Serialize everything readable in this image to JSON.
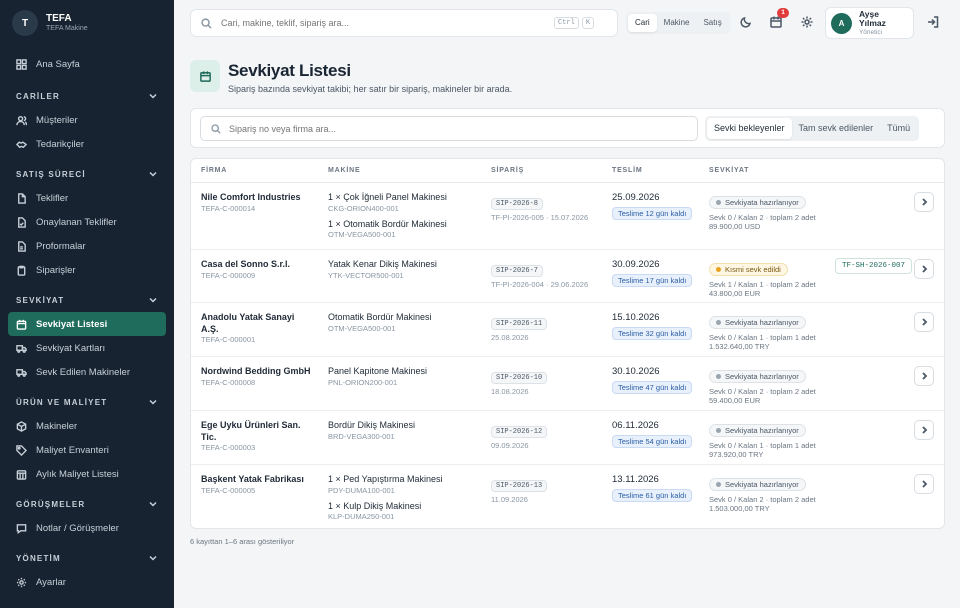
{
  "brand": {
    "logo_letter": "T",
    "name": "TEFA",
    "subtitle": "TEFA Makine"
  },
  "sidebar": {
    "home": "Ana Sayfa",
    "sections": [
      {
        "title": "CARİLER",
        "items": [
          "Müşteriler",
          "Tedarikçiler"
        ]
      },
      {
        "title": "SATIŞ SÜRECİ",
        "items": [
          "Teklifler",
          "Onaylanan Teklifler",
          "Proformalar",
          "Siparişler"
        ]
      },
      {
        "title": "SEVKİYAT",
        "items": [
          "Sevkiyat Listesi",
          "Sevkiyat Kartları",
          "Sevk Edilen Makineler"
        ]
      },
      {
        "title": "ÜRÜN VE MALİYET",
        "items": [
          "Makineler",
          "Maliyet Envanteri",
          "Aylık Maliyet Listesi"
        ]
      },
      {
        "title": "GÖRÜŞMELER",
        "items": [
          "Notlar / Görüşmeler"
        ]
      },
      {
        "title": "YÖNETİM",
        "items": [
          "Ayarlar"
        ]
      }
    ],
    "active_item": "Sevkiyat Listesi"
  },
  "topbar": {
    "search_placeholder": "Cari, makine, teklif, sipariş ara...",
    "kbd1": "Ctrl",
    "kbd2": "K",
    "scopes": [
      "Cari",
      "Makine",
      "Satış"
    ],
    "active_scope": "Cari",
    "notification_count": "1",
    "user_initial": "A",
    "user_name": "Ayşe Yılmaz",
    "user_role": "Yönetici"
  },
  "page": {
    "title": "Sevkiyat Listesi",
    "subtitle": "Sipariş bazında sevkiyat takibi; her satır bir sipariş, makineler bir arada."
  },
  "filters": {
    "search_placeholder": "Sipariş no veya firma ara...",
    "tabs": [
      "Sevki bekleyenler",
      "Tam sevk edilenler",
      "Tümü"
    ],
    "active_tab": "Sevki bekleyenler"
  },
  "table": {
    "headers": [
      "FİRMA",
      "MAKİNE",
      "SİPARİŞ",
      "TESLİM",
      "SEVKİYAT"
    ],
    "rows": [
      {
        "firm": "Nile Comfort Industries",
        "firm_code": "TEFA-C-000014",
        "machines": [
          {
            "name": "1 × Çok İğneli Panel Makinesi",
            "code": "CKG-ORION400-001"
          },
          {
            "name": "1 × Otomatik Bordür Makinesi",
            "code": "OTM-VEGA500-001"
          }
        ],
        "order_no": "SIP-2026-8",
        "order_meta": "TF-PI-2026-005 · 15.07.2026",
        "delivery_date": "25.09.2026",
        "delivery_badge": "Teslime 12 gün kaldı",
        "status": "Sevkiyata hazırlanıyor",
        "status_type": "neutral",
        "ship_meta": "Sevk 0 / Kalan 2 · toplam 2 adet",
        "amount": "89.900,00 USD",
        "tag": ""
      },
      {
        "firm": "Casa del Sonno S.r.l.",
        "firm_code": "TEFA-C-000009",
        "machines": [
          {
            "name": "Yatak Kenar Dikiş Makinesi",
            "code": "YTK-VECTOR500-001"
          }
        ],
        "order_no": "SIP-2026-7",
        "order_meta": "TF-PI-2026-004 · 29.06.2026",
        "delivery_date": "30.09.2026",
        "delivery_badge": "Teslime 17 gün kaldı",
        "status": "Kısmi sevk edildi",
        "status_type": "warn",
        "ship_meta": "Sevk 1 / Kalan 1 · toplam 2 adet",
        "amount": "43.800,00 EUR",
        "tag": "TF-SH-2026-007"
      },
      {
        "firm": "Anadolu Yatak Sanayi A.Ş.",
        "firm_code": "TEFA-C-000001",
        "machines": [
          {
            "name": "Otomatik Bordür Makinesi",
            "code": "OTM-VEGA500-001"
          }
        ],
        "order_no": "SIP-2026-11",
        "order_meta": "25.08.2026",
        "delivery_date": "15.10.2026",
        "delivery_badge": "Teslime 32 gün kaldı",
        "status": "Sevkiyata hazırlanıyor",
        "status_type": "neutral",
        "ship_meta": "Sevk 0 / Kalan 1 · toplam 1 adet",
        "amount": "1.532.640,00 TRY",
        "tag": ""
      },
      {
        "firm": "Nordwind Bedding GmbH",
        "firm_code": "TEFA-C-000008",
        "machines": [
          {
            "name": "Panel Kapitone Makinesi",
            "code": "PNL-ORION200-001"
          }
        ],
        "order_no": "SIP-2026-10",
        "order_meta": "18.08.2026",
        "delivery_date": "30.10.2026",
        "delivery_badge": "Teslime 47 gün kaldı",
        "status": "Sevkiyata hazırlanıyor",
        "status_type": "neutral",
        "ship_meta": "Sevk 0 / Kalan 2 · toplam 2 adet",
        "amount": "59.400,00 EUR",
        "tag": ""
      },
      {
        "firm": "Ege Uyku Ürünleri San. Tic.",
        "firm_code": "TEFA-C-000003",
        "machines": [
          {
            "name": "Bordür Dikiş Makinesi",
            "code": "BRD-VEGA300-001"
          }
        ],
        "order_no": "SIP-2026-12",
        "order_meta": "09.09.2026",
        "delivery_date": "06.11.2026",
        "delivery_badge": "Teslime 54 gün kaldı",
        "status": "Sevkiyata hazırlanıyor",
        "status_type": "neutral",
        "ship_meta": "Sevk 0 / Kalan 1 · toplam 1 adet",
        "amount": "973.920,00 TRY",
        "tag": ""
      },
      {
        "firm": "Başkent Yatak Fabrikası",
        "firm_code": "TEFA-C-000005",
        "machines": [
          {
            "name": "1 × Ped Yapıştırma Makinesi",
            "code": "PDY-DUMA100-001"
          },
          {
            "name": "1 × Kulp Dikiş Makinesi",
            "code": "KLP-DUMA250-001"
          }
        ],
        "order_no": "SIP-2026-13",
        "order_meta": "11.09.2026",
        "delivery_date": "13.11.2026",
        "delivery_badge": "Teslime 61 gün kaldı",
        "status": "Sevkiyata hazırlanıyor",
        "status_type": "neutral",
        "ship_meta": "Sevk 0 / Kalan 2 · toplam 2 adet",
        "amount": "1.503.000,00 TRY",
        "tag": ""
      }
    ]
  },
  "footer": "6 kayıttan 1–6 arası gösteriliyor"
}
